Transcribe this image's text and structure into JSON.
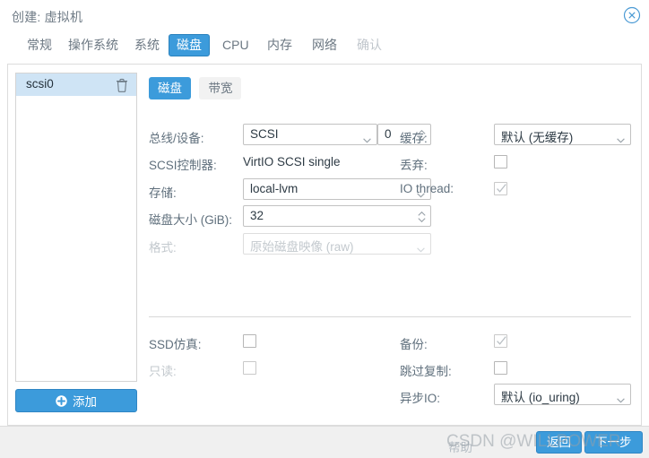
{
  "window": {
    "title": "创建: 虚拟机",
    "close_icon": "close-circle-icon"
  },
  "tabs": [
    {
      "label": "常规",
      "state": "normal"
    },
    {
      "label": "操作系统",
      "state": "normal"
    },
    {
      "label": "系统",
      "state": "normal"
    },
    {
      "label": "磁盘",
      "state": "selected"
    },
    {
      "label": "CPU",
      "state": "normal"
    },
    {
      "label": "内存",
      "state": "normal"
    },
    {
      "label": "网络",
      "state": "normal"
    },
    {
      "label": "确认",
      "state": "disabled"
    }
  ],
  "device_list": {
    "items": [
      {
        "name": "scsi0",
        "selected": true,
        "delete_icon": "trash-icon"
      }
    ],
    "add_button": {
      "label": "添加",
      "icon": "plus-circle-icon"
    }
  },
  "subtabs": [
    {
      "label": "磁盘",
      "state": "selected"
    },
    {
      "label": "带宽",
      "state": "normal"
    }
  ],
  "form": {
    "bus_device": {
      "label": "总线/设备:",
      "bus_value": "SCSI",
      "device_index": "0"
    },
    "scsi_controller": {
      "label": "SCSI控制器:",
      "value": "VirtIO SCSI single"
    },
    "storage": {
      "label": "存储:",
      "value": "local-lvm"
    },
    "disk_size": {
      "label": "磁盘大小 (GiB):",
      "value": "32"
    },
    "format": {
      "label": "格式:",
      "value": "原始磁盘映像 (raw)",
      "disabled": true
    },
    "cache": {
      "label": "缓存:",
      "value": "默认 (无缓存)"
    },
    "discard": {
      "label": "丢弃:",
      "checked": false
    },
    "io_thread": {
      "label": "IO thread:",
      "checked": true,
      "disabled": true
    },
    "ssd_emulation": {
      "label": "SSD仿真:",
      "checked": false
    },
    "read_only": {
      "label": "只读:",
      "checked": false,
      "disabled": true
    },
    "backup": {
      "label": "备份:",
      "checked": true,
      "disabled": true
    },
    "skip_replication": {
      "label": "跳过复制:",
      "checked": false
    },
    "async_io": {
      "label": "异步IO:",
      "value": "默认 (io_uring)"
    }
  },
  "footer": {
    "help_label": "帮助",
    "back_label": "返回",
    "next_label": "下一步"
  },
  "watermark": {
    "text": "CSDN @WILLPOWER"
  },
  "colors": {
    "accent": "#3c9bdb",
    "accent_border": "#2f86c4",
    "selection": "#cfe4f5",
    "label_text": "#60707d",
    "value_text": "#2d3a44",
    "disabled_text": "#c3c9ce"
  }
}
